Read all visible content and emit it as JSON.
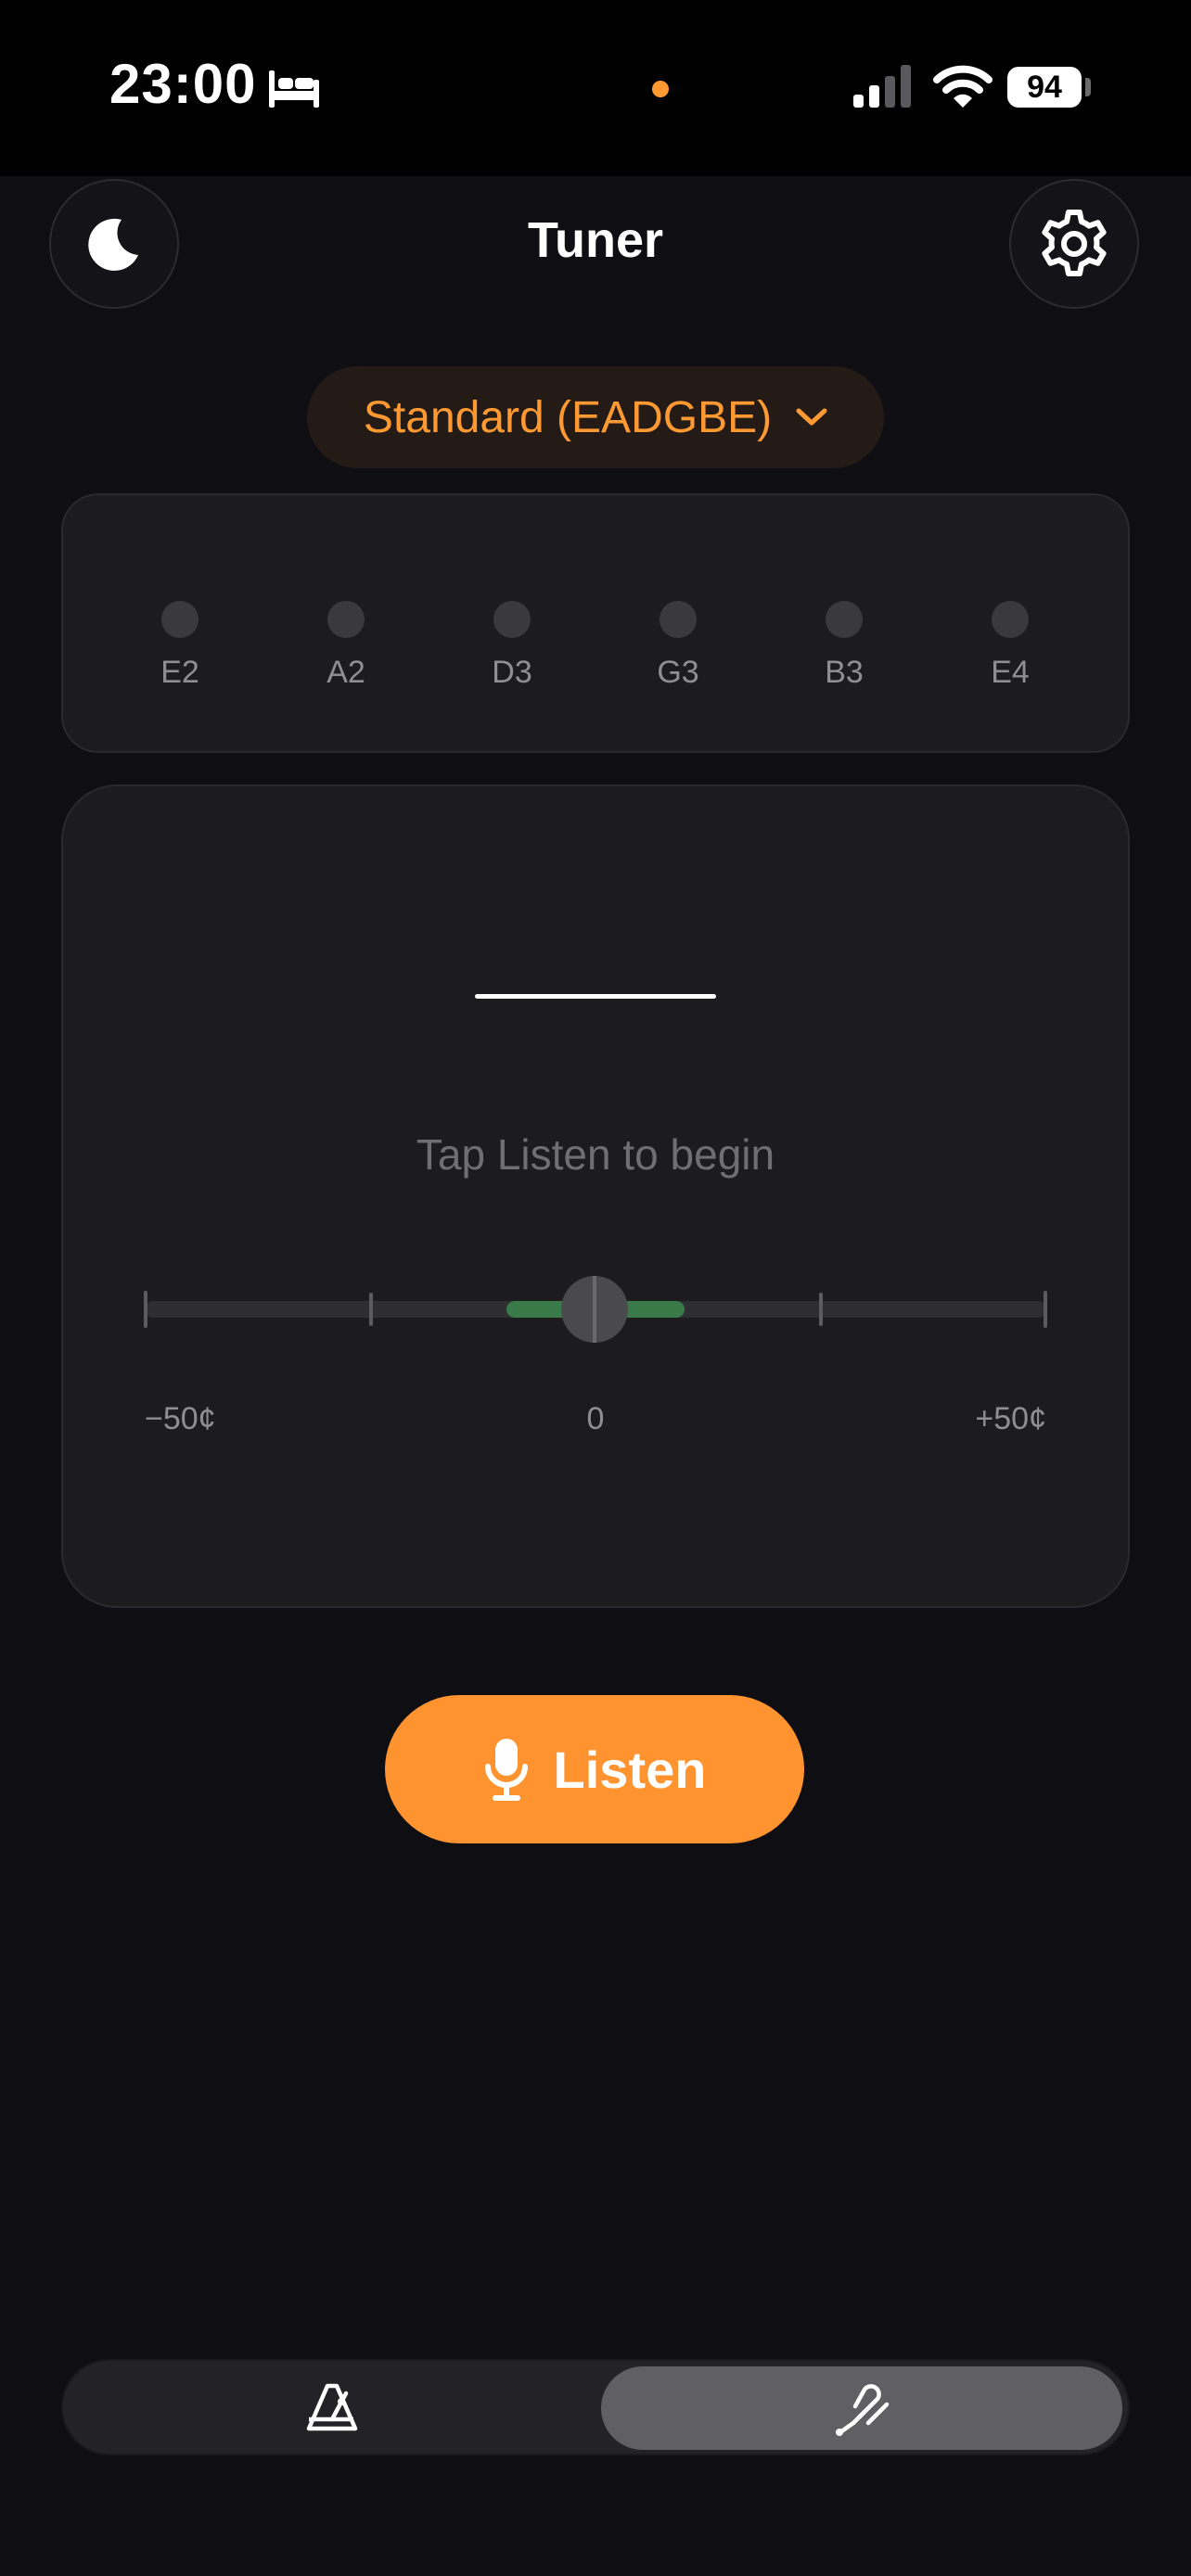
{
  "status_bar": {
    "time": "23:00",
    "battery": "94",
    "icons": [
      "bed-icon",
      "orange-dot",
      "signal-icon",
      "wifi-icon",
      "battery-icon"
    ]
  },
  "header": {
    "title": "Tuner",
    "left_icon": "moon-icon",
    "right_icon": "gear-icon"
  },
  "tuning": {
    "label": "Standard (EADGBE)",
    "icon": "chevron-down-icon"
  },
  "strings": [
    "E2",
    "A2",
    "D3",
    "G3",
    "B3",
    "E4"
  ],
  "meter": {
    "note": "",
    "prompt": "Tap Listen to begin",
    "scale_min": "−50¢",
    "scale_mid": "0",
    "scale_max": "+50¢",
    "cents": 0
  },
  "listen_button": {
    "label": "Listen",
    "icon": "microphone-icon"
  },
  "tabs": [
    {
      "icon": "metronome-icon",
      "selected": false
    },
    {
      "icon": "tuning-fork-icon",
      "selected": true
    }
  ],
  "colors": {
    "accent": "#ff9330",
    "background": "#0f0e13",
    "card": "#1c1c1e",
    "in_tune": "#3a7a48"
  }
}
